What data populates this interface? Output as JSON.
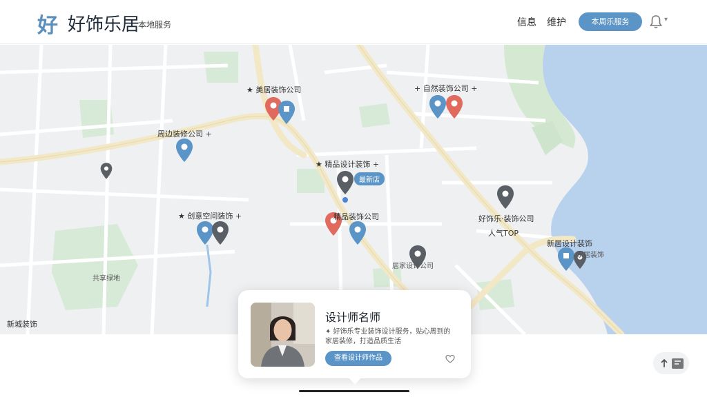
{
  "header": {
    "logo_mark": "好",
    "brand": "好饰乐居",
    "brand_sub": "本地服务",
    "nav": [
      {
        "label": "信息"
      },
      {
        "label": "维护"
      }
    ],
    "cta_label": "本周乐服务"
  },
  "map": {
    "labels": [
      {
        "text": "★ 美居装饰公司"
      },
      {
        "text": "+ 自然装饰公司 +"
      },
      {
        "text": "周边装修公司 +"
      },
      {
        "text": "★ 精品设计装饰 +"
      },
      {
        "text": "★ 创意空间装饰 +"
      },
      {
        "text": "精品装饰公司"
      },
      {
        "text": "好饰乐·装饰公司"
      },
      {
        "text": "人气TOP"
      },
      {
        "text": "新居设计装饰"
      },
      {
        "text": "家居装饰"
      },
      {
        "text": "居家设计公司"
      },
      {
        "text": "共享绿地"
      },
      {
        "text": "新城装饰"
      }
    ],
    "tag": "最新店"
  },
  "card": {
    "title": "设计师名师",
    "desc": "✦ 好饰乐专业装饰设计服务，贴心周到的家居装修，打造品质生活",
    "button": "查看设计师作品"
  },
  "colors": {
    "accent": "#5b94c6",
    "pin_blue": "#5b94c6",
    "pin_red": "#e06a5e",
    "pin_gray": "#5a5f66",
    "water": "#b8d2ee",
    "park": "#d7ead7"
  }
}
